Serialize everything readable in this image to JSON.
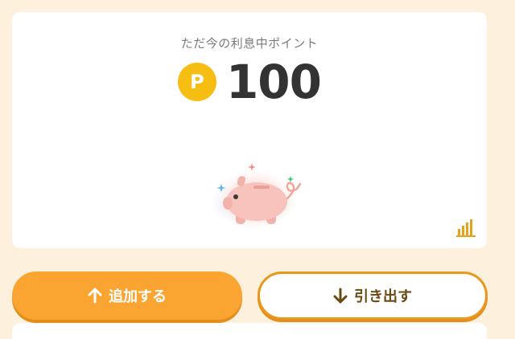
{
  "card": {
    "subtitle": "ただ今の利息中ポイント",
    "point_badge": "P",
    "points": "100",
    "pig_icon": "piggy-bank-icon",
    "chart_icon": "bar-chart-icon"
  },
  "actions": {
    "add_label": "追加する",
    "add_icon": "arrow-up-icon",
    "withdraw_label": "引き出す",
    "withdraw_icon": "arrow-down-icon"
  },
  "colors": {
    "background": "#fdf0dc",
    "accent_orange": "#faa531",
    "badge_yellow": "#f6be12",
    "text_dark": "#333333"
  }
}
